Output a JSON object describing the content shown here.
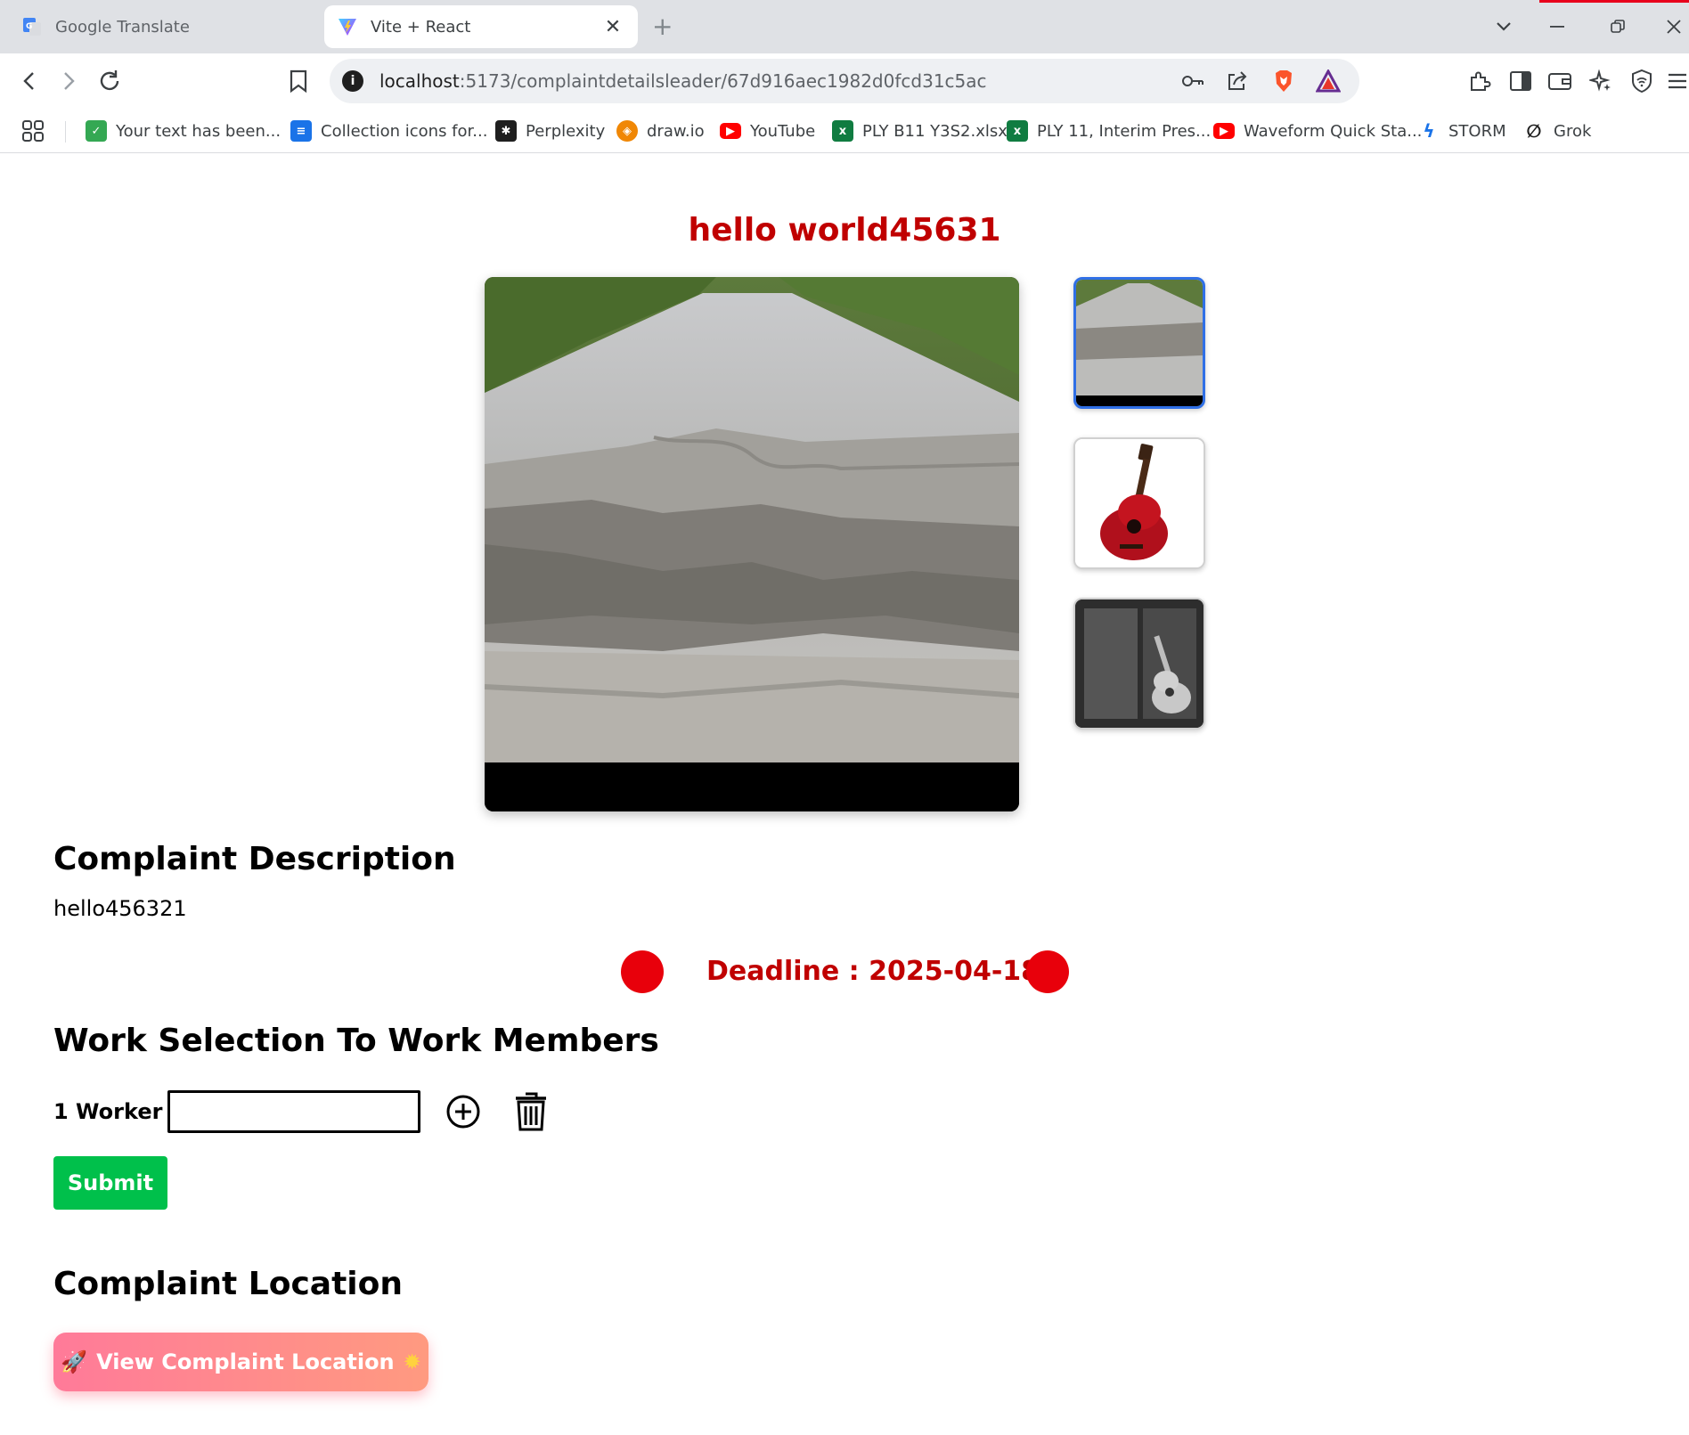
{
  "browser": {
    "tabs": [
      {
        "title": "Google Translate",
        "active": false
      },
      {
        "title": "Vite + React",
        "active": true
      }
    ],
    "url_host": "localhost",
    "url_rest": ":5173/complaintdetailsleader/67d916aec1982d0fcd31c5ac",
    "bookmarks": [
      {
        "label": "Your text has been...",
        "icon": "checkbox-icon",
        "color": "#34a853"
      },
      {
        "label": "Collection icons for...",
        "icon": "document-icon",
        "color": "#1a73e8"
      },
      {
        "label": "Perplexity",
        "icon": "perplexity-icon",
        "color": "#1f1f1f"
      },
      {
        "label": "draw.io",
        "icon": "drawio-icon",
        "color": "#f08705"
      },
      {
        "label": "YouTube",
        "icon": "youtube-icon",
        "color": "#ff0000"
      },
      {
        "label": "PLY B11 Y3S2.xlsx",
        "icon": "excel-icon",
        "color": "#107c41"
      },
      {
        "label": "PLY 11, Interim Pres...",
        "icon": "excel-icon",
        "color": "#107c41"
      },
      {
        "label": "Waveform Quick Sta...",
        "icon": "youtube-icon",
        "color": "#ff0000"
      },
      {
        "label": "STORM",
        "icon": "lightning-icon",
        "color": "#1a73e8"
      },
      {
        "label": "Grok",
        "icon": "grok-icon",
        "color": "#1f1f1f"
      }
    ]
  },
  "complaint": {
    "title": "hello world45631",
    "description_heading": "Complaint Description",
    "description": "hello456321",
    "deadline": "Deadline : 2025-04-18",
    "work_heading": "Work Selection To Work Members",
    "worker_label": "1 Worker",
    "worker_value": "",
    "submit_label": "Submit",
    "location_heading": "Complaint Location",
    "location_button": "View Complaint Location",
    "location_button_icons": [
      "rocket-icon",
      "sun-icon"
    ],
    "images": [
      "road-damage-image",
      "red-guitar-image",
      "acoustic-guitar-bw-image"
    ]
  },
  "colors": {
    "title_red": "#c00000",
    "status_dot": "#e8000b",
    "submit_green": "#00c04b",
    "thumb_selected": "#2f6fe6"
  }
}
